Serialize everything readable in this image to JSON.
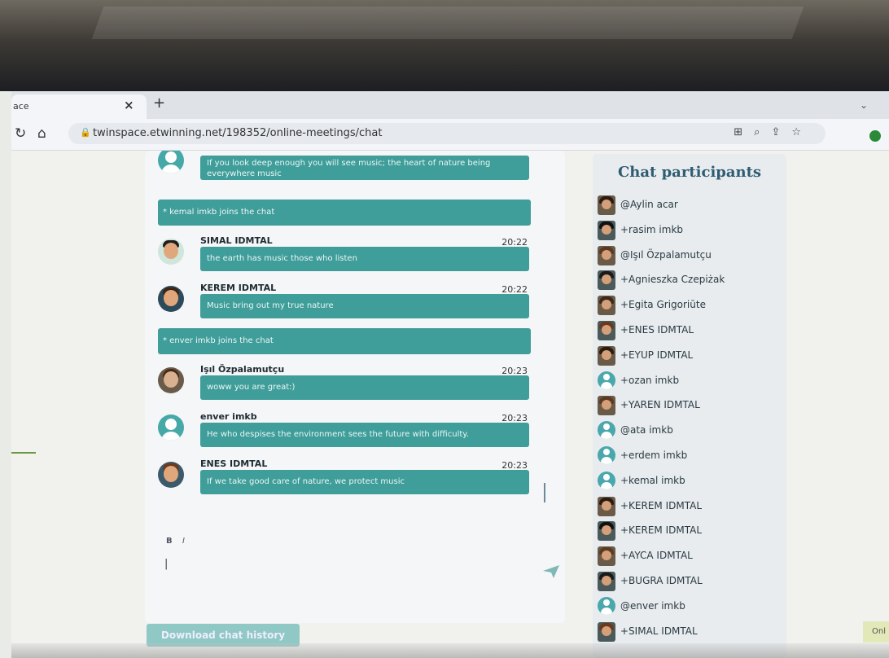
{
  "browser": {
    "tab_title": "ace",
    "tab_close": "×",
    "new_tab": "+",
    "url": "twinspace.etwinning.net/198352/online-meetings/chat"
  },
  "chat": {
    "messages": [
      {
        "type": "user",
        "sender": "",
        "time": "",
        "text": "If you look deep enough you will see music; the heart of nature being everywhere music",
        "avatar": "default"
      },
      {
        "type": "system",
        "text": "* kemal imkb joins the chat"
      },
      {
        "type": "user",
        "sender": "SIMAL IDMTAL",
        "time": "20:22",
        "text": "the earth has music those who listen",
        "avatar": "bitmoji"
      },
      {
        "type": "user",
        "sender": "KEREM IDMTAL",
        "time": "20:22",
        "text": "Music bring out my true nature",
        "avatar": "bitmoji"
      },
      {
        "type": "system",
        "text": "* enver imkb joins the chat"
      },
      {
        "type": "user",
        "sender": "Işıl Özpalamutçu",
        "time": "20:23",
        "text": "woww you are great:)",
        "avatar": "photo"
      },
      {
        "type": "user",
        "sender": "enver imkb",
        "time": "20:23",
        "text": "He who despises the environment sees the future with difficulty.",
        "avatar": "default"
      },
      {
        "type": "user",
        "sender": "ENES IDMTAL",
        "time": "20:23",
        "text": "If we take good care of nature, we protect music",
        "avatar": "bitmoji"
      }
    ],
    "format_bold": "B",
    "format_italic": "I",
    "download_label": "Download chat history"
  },
  "participants": {
    "title": "Chat participants",
    "list": [
      {
        "name": "@Aylin acar",
        "avatar": "photo"
      },
      {
        "name": "+rasim imkb",
        "avatar": "photo"
      },
      {
        "name": "@Işıl Özpalamutçu",
        "avatar": "photo"
      },
      {
        "name": "+Agnieszka Czepiżak",
        "avatar": "photo"
      },
      {
        "name": "+Egita Grigoriūte",
        "avatar": "photo"
      },
      {
        "name": "+ENES IDMTAL",
        "avatar": "photo"
      },
      {
        "name": "+EYUP IDMTAL",
        "avatar": "photo"
      },
      {
        "name": "+ozan imkb",
        "avatar": "default"
      },
      {
        "name": "+YAREN IDMTAL",
        "avatar": "photo"
      },
      {
        "name": "@ata imkb",
        "avatar": "default"
      },
      {
        "name": "+erdem imkb",
        "avatar": "default"
      },
      {
        "name": "+kemal imkb",
        "avatar": "default"
      },
      {
        "name": "+KEREM IDMTAL",
        "avatar": "photo"
      },
      {
        "name": "+KEREM IDMTAL",
        "avatar": "photo"
      },
      {
        "name": "+AYCA IDMTAL",
        "avatar": "photo"
      },
      {
        "name": "+BUGRA IDMTAL",
        "avatar": "photo"
      },
      {
        "name": "@enver imkb",
        "avatar": "default"
      },
      {
        "name": "+SIMAL IDMTAL",
        "avatar": "photo"
      }
    ]
  },
  "corner_button": "Onl",
  "colors": {
    "bubble": "#3f9d9a",
    "title": "#2f5b73",
    "download": "#8fc8c4"
  }
}
